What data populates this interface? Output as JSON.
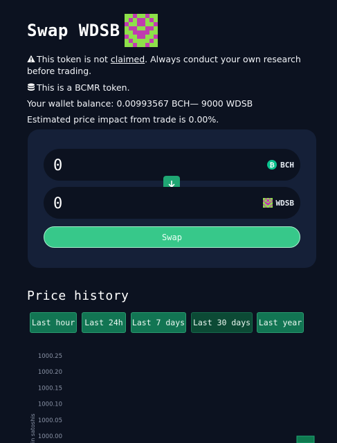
{
  "header": {
    "title": "Swap WDSB",
    "token_icon": "wdsb-pixel-icon"
  },
  "notices": {
    "unclaimed_before": "This token is not ",
    "unclaimed_link": "claimed",
    "unclaimed_after": ". Always conduct your own research before trading.",
    "bcmr": "This is a BCMR token.",
    "balance": "Your wallet balance: 0.00993567 BCH— 9000 WDSB",
    "impact": "Estimated price impact from trade is 0.00%."
  },
  "swap": {
    "from_amount": "0",
    "from_token": "BCH",
    "to_amount": "0",
    "to_token": "WDSB",
    "button_label": "Swap",
    "colors": {
      "accent": "#37c88a",
      "panel": "#152038",
      "bch": "#0ac18e"
    }
  },
  "price_history": {
    "title": "Price history",
    "ranges": [
      "Last hour",
      "Last 24h",
      "Last 7 days",
      "Last 30 days",
      "Last year"
    ],
    "selected_range": "Last 30 days"
  },
  "chart_data": {
    "type": "bar",
    "ylabel": "in satoshis",
    "ylim": [
      1000.0,
      1000.25
    ],
    "y_ticks": [
      "1000.25",
      "1000.20",
      "1000.15",
      "1000.10",
      "1000.05",
      "1000.00"
    ],
    "values": [
      1000.0
    ],
    "grid": false,
    "bar_color": "#0f7a50"
  }
}
